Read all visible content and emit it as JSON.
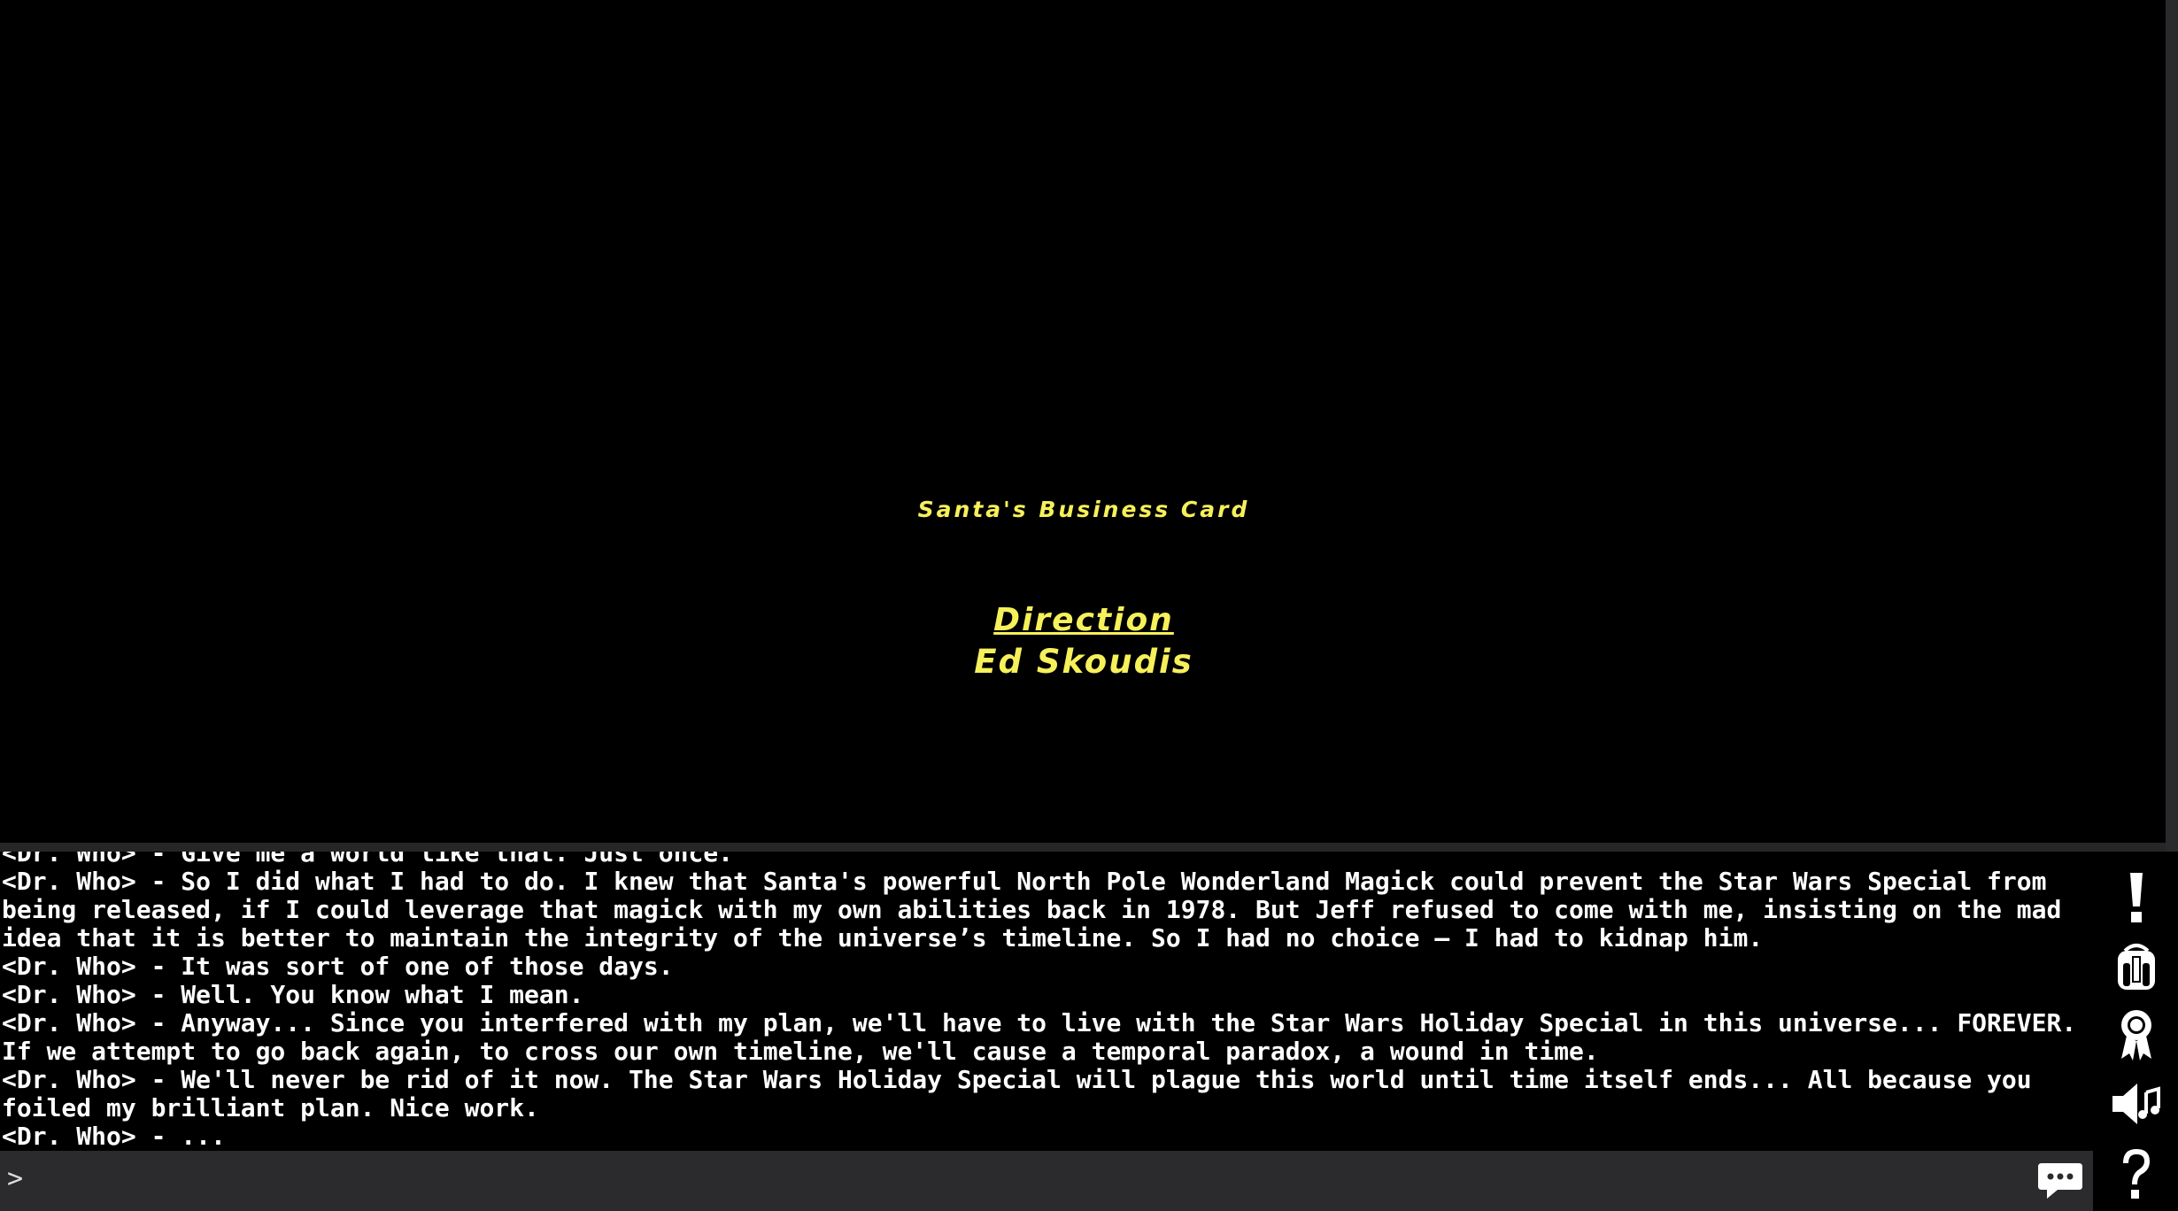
{
  "credits": {
    "title": "Santa's Business Card",
    "role": "Direction",
    "name": "Ed Skoudis"
  },
  "chat": {
    "lines": [
      "<Dr. Who> - Give me a world like that. Just once.",
      "<Dr. Who> - So I did what I had to do. I knew that Santa's powerful North Pole Wonderland Magick could prevent the Star Wars Special from being released, if I could leverage that magick with my own abilities back in 1978. But Jeff refused to come with me, insisting on the mad idea that it is better to maintain the integrity of the universe’s timeline. So I had no choice – I had to kidnap him.",
      "<Dr. Who> - It was sort of one of those days.",
      "<Dr. Who> - Well. You know what I mean.",
      "<Dr. Who> - Anyway... Since you interfered with my plan, we'll have to live with the Star Wars Holiday Special in this universe... FOREVER. If we attempt to go back again, to cross our own timeline, we'll cause a temporal paradox, a wound in time.",
      "<Dr. Who> - We'll never be rid of it now. The Star Wars Holiday Special will plague this world until time itself ends... All because you foiled my brilliant plan. Nice work.",
      "<Dr. Who> - ..."
    ],
    "prompt": ">",
    "input_value": ""
  },
  "sidebar": {
    "icons": [
      "exclamation-icon",
      "backpack-icon",
      "achievement-ribbon-icon",
      "speaker-icon",
      "help-question-icon"
    ]
  },
  "colors": {
    "credit_yellow": "#f6f05a",
    "panel_gray": "#2b2b2e",
    "background": "#000000"
  }
}
